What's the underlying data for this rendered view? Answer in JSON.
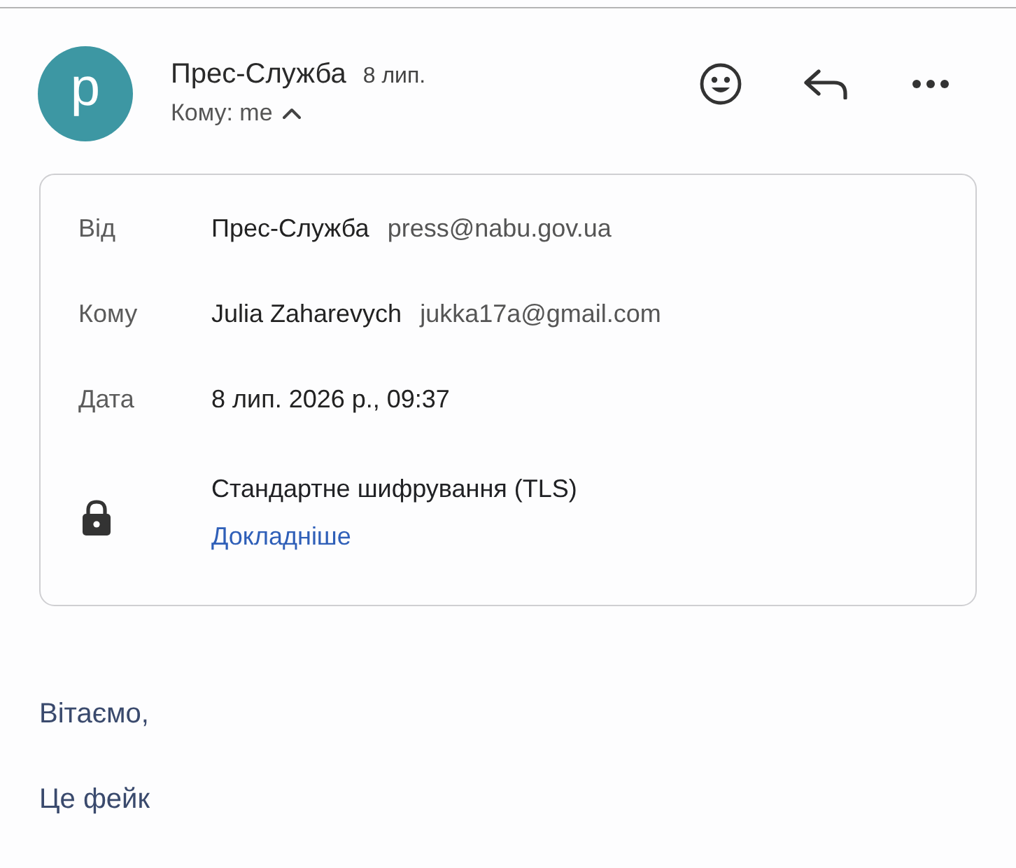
{
  "header": {
    "avatar_letter": "p",
    "sender": "Прес-Служба",
    "date": "8 лип.",
    "recipient_summary": "Кому: me",
    "expanded": true
  },
  "details": {
    "rows": [
      {
        "kind": "field",
        "label": "Від",
        "name": "Прес-Служба",
        "address": "press@nabu.gov.ua"
      },
      {
        "kind": "field",
        "label": "Кому",
        "name": "Julia Zaharevych",
        "address": "jukka17a@gmail.com"
      },
      {
        "kind": "field",
        "label": "Дата",
        "name": "8 лип. 2026 р., 09:37"
      },
      {
        "kind": "security",
        "text": "Стандартне шифрування (TLS)",
        "link": "Докладніше"
      }
    ]
  },
  "body": {
    "paragraphs": [
      "Вітаємо,",
      "Це фейк"
    ]
  }
}
